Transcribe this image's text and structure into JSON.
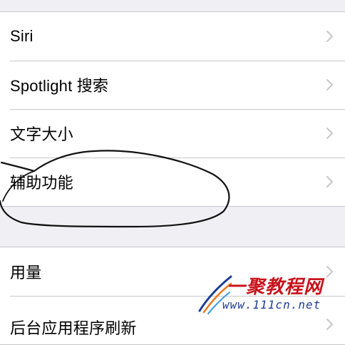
{
  "groups": [
    {
      "rows": [
        {
          "label": "Siri"
        },
        {
          "label": "Spotlight 搜索"
        },
        {
          "label": "文字大小"
        },
        {
          "label": "辅助功能"
        }
      ]
    },
    {
      "rows": [
        {
          "label": "用量"
        },
        {
          "label": "后台应用程序刷新"
        }
      ]
    }
  ],
  "icons": {
    "row_chevron": "chevron-right-icon"
  },
  "colors": {
    "background": "#efeff4",
    "row_background": "#ffffff",
    "separator": "#c8c7cc",
    "chevron": "#c7c7cc",
    "annotation_ink": "#111111",
    "watermark_red": "#c8141c",
    "watermark_blue": "#1b3d94"
  },
  "watermark": {
    "main": "一聚教程网",
    "url": "www.111cn.net"
  }
}
